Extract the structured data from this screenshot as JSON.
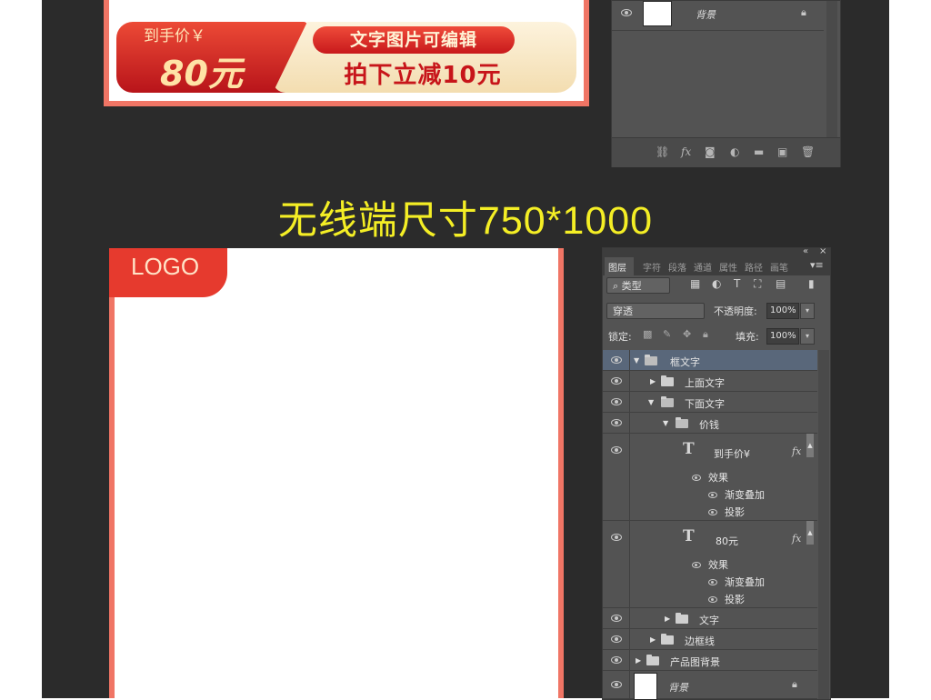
{
  "top_banner": {
    "price_label": "到手价￥",
    "price_value": "80元",
    "pill_text": "文字图片可编辑",
    "sub_text": "拍下立减10元"
  },
  "top_panel": {
    "background_layer": "背景",
    "footer_icons": [
      "link-icon",
      "fx-icon",
      "mask-icon",
      "adjustment-icon",
      "folder-icon",
      "new-layer-icon",
      "trash-icon"
    ]
  },
  "size_title": "无线端尺寸750*1000",
  "artboard": {
    "logo": "LOGO"
  },
  "layers_panel": {
    "tabs": [
      "图层",
      "字符",
      "段落",
      "通道",
      "属性",
      "路径",
      "画笔"
    ],
    "filter_label": "类型",
    "blend_mode": "穿透",
    "opacity_label": "不透明度:",
    "opacity_value": "100%",
    "lock_label": "锁定:",
    "fill_label": "填充:",
    "fill_value": "100%",
    "layers": {
      "frame_text": "框文字",
      "upper_text": "上面文字",
      "lower_text": "下面文字",
      "price_group": "价钱",
      "text_layer_1": "到手价¥",
      "effects_1": "效果",
      "gradient_1": "渐变叠加",
      "shadow_1": "投影",
      "text_layer_2": "80元",
      "effects_2": "效果",
      "gradient_2": "渐变叠加",
      "shadow_2": "投影",
      "text_group": "文字",
      "border_line": "边框线",
      "product_bg": "产品图背景",
      "background": "背景"
    }
  },
  "colors": {
    "accent_red": "#e63a2e",
    "frame_coral": "#f07565",
    "title_yellow": "#f4ee25",
    "selected_row": "#59677a"
  }
}
